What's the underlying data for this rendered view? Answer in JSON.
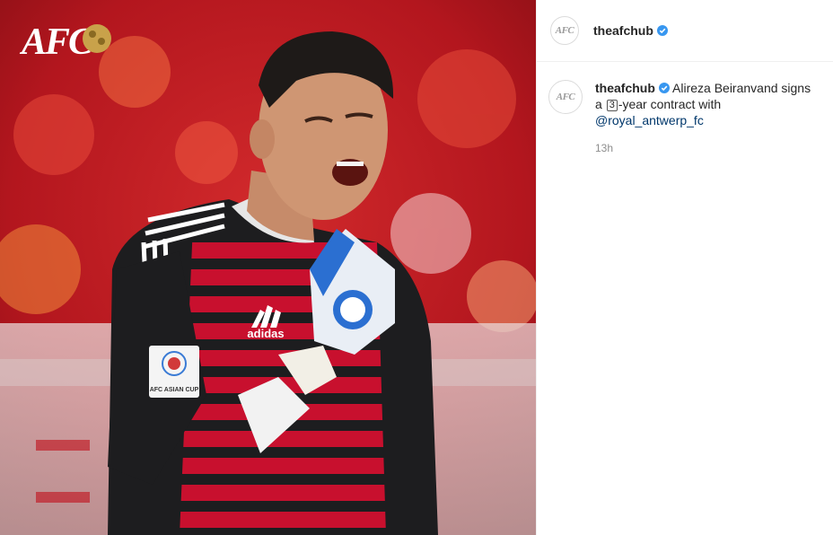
{
  "post": {
    "image_logo_text": "AFC",
    "username": "theafchub",
    "avatar_text": "AFC",
    "caption": {
      "username": "theafchub",
      "text_before": "Alireza Beiranvand signs a ",
      "number_emoji": "3",
      "text_after": "-year contract with ",
      "mention": "@royal_antwerp_fc"
    },
    "timestamp": "13h",
    "kit_brand": "adidas",
    "patch_text": "AFC ASIAN CUP",
    "colors": {
      "verified": "#3897f0",
      "jersey_red": "#c8102e",
      "jersey_dark": "#1d1d1f"
    }
  }
}
